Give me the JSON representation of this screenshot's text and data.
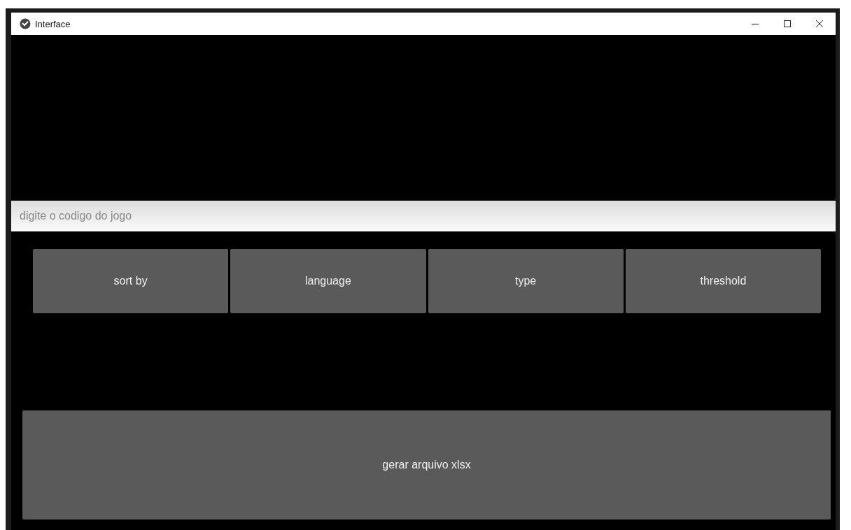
{
  "window": {
    "title": "Interface"
  },
  "search": {
    "placeholder": "digite o codigo do jogo"
  },
  "options": [
    {
      "label": "sort by"
    },
    {
      "label": "language"
    },
    {
      "label": "type"
    },
    {
      "label": "threshold"
    }
  ],
  "action": {
    "label": "gerar arquivo xlsx"
  }
}
